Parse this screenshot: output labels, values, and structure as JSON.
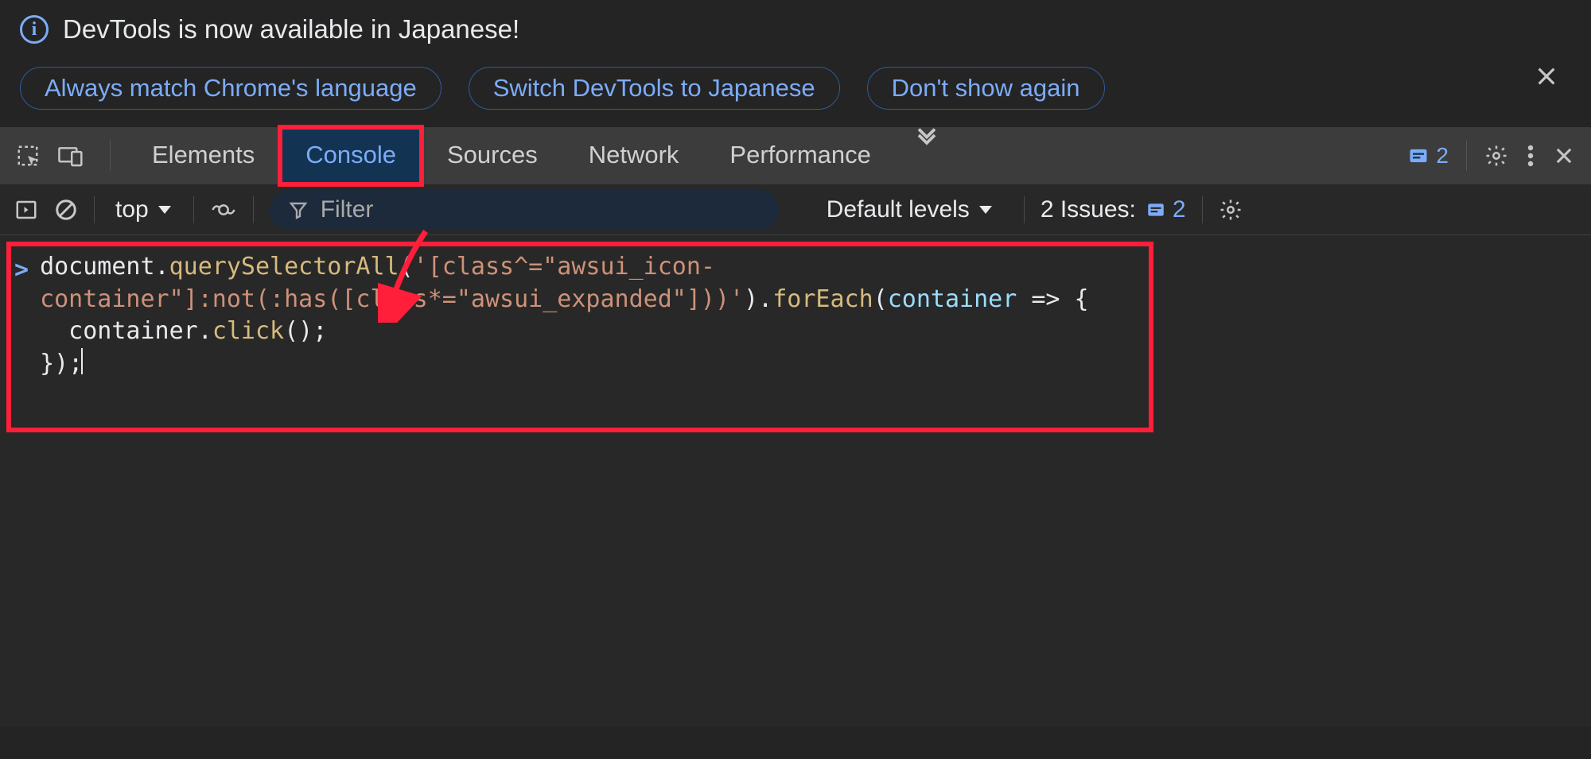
{
  "infoBar": {
    "title": "DevTools is now available in Japanese!",
    "buttons": {
      "alwaysMatch": "Always match Chrome's language",
      "switch": "Switch DevTools to Japanese",
      "dontShow": "Don't show again"
    }
  },
  "tabs": {
    "elements": "Elements",
    "console": "Console",
    "sources": "Sources",
    "network": "Network",
    "performance": "Performance"
  },
  "tabbarRight": {
    "issuesCount": "2"
  },
  "subbar": {
    "context": "top",
    "filterPlaceholder": "Filter",
    "levelsLabel": "Default levels",
    "issuesLabel": "2 Issues:",
    "issuesBadge": "2"
  },
  "console": {
    "promptGlyph": ">",
    "line1a": "document.",
    "line1b": "querySelectorAll",
    "line1c": "(",
    "line1d": "'[class^=\"awsui_icon-",
    "line2a": "container\"]:not(:has([class*=\"awsui_expanded\"]))'",
    "line2b": ").",
    "line2c": "forEach",
    "line2d": "(",
    "line2e": "container",
    "line2f": " => {",
    "line3a": "  container.",
    "line3b": "click",
    "line3c": "();",
    "line4a": "});"
  }
}
